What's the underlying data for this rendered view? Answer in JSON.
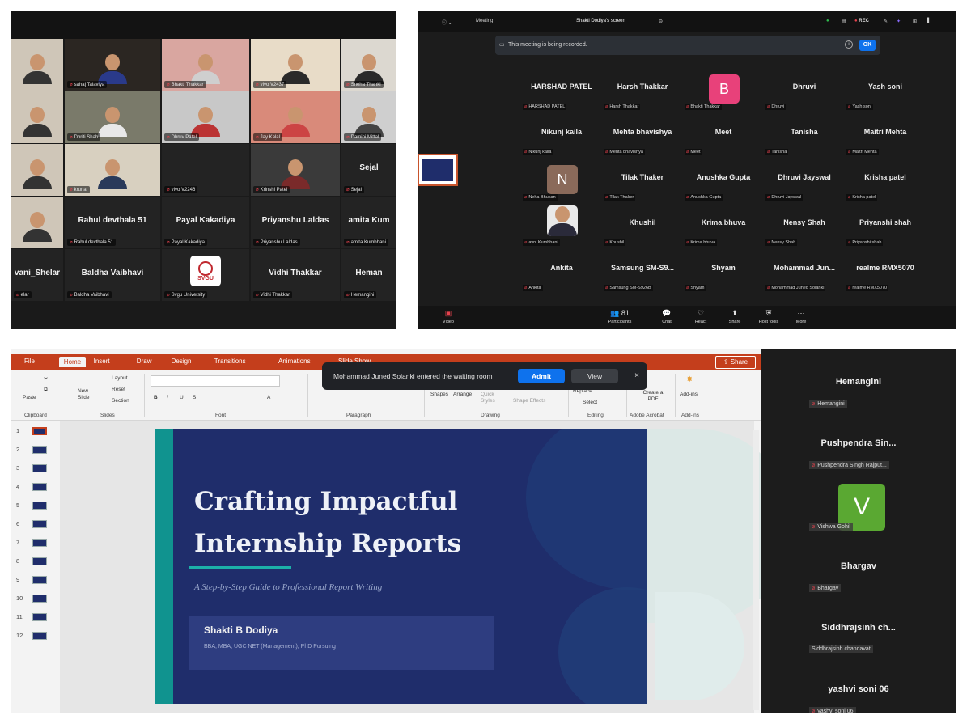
{
  "gallery1": {
    "tiles": [
      {
        "name": "sahaj Talaviya",
        "type": "video",
        "bg": "#2b2622",
        "shirt": "#2a3a8a"
      },
      {
        "name": "Bhakti Thakkar",
        "type": "video",
        "bg": "#d9a6a0",
        "shirt": "#cfcfcf"
      },
      {
        "name": "vivo V2437",
        "type": "video",
        "bg": "#e8dcc8",
        "shirt": "#2a2a2a"
      },
      {
        "name": "Sneha Thanki",
        "type": "video",
        "bg": "#dcd8d0",
        "shirt": "#2a2a2a"
      },
      {
        "name": "Dhriti Shah",
        "type": "video",
        "bg": "#7a7a6a",
        "shirt": "#e8e8e8"
      },
      {
        "name": "Dhruv Patel",
        "type": "video",
        "bg": "#c8c8c8",
        "shirt": "#b33"
      },
      {
        "name": "Jay Kalal",
        "type": "video",
        "bg": "#d98a7a",
        "shirt": "#c44"
      },
      {
        "name": "Damini Mittal",
        "type": "video",
        "bg": "#cfcfcf",
        "shirt": "#444"
      },
      {
        "name": "krunal",
        "type": "video",
        "bg": "#d8d0c0",
        "shirt": "#2a3a5a"
      },
      {
        "name": "vivo V2246",
        "type": "avatar"
      },
      {
        "name": "Krinshi Patel",
        "type": "video",
        "bg": "#3a3a3a",
        "shirt": "#7a2a2a"
      },
      {
        "name": "Sejal",
        "type": "big"
      },
      {
        "name": "Rahul devthala 51",
        "type": "big"
      },
      {
        "name": "Payal Kakadiya",
        "type": "big"
      },
      {
        "name": "Priyanshu Laldas",
        "type": "big"
      },
      {
        "name": "amita Kumbhani",
        "big_label": "amita Kum",
        "type": "big"
      },
      {
        "name": "elar",
        "big_label": "vani_Shelar",
        "type": "big"
      },
      {
        "name": "Baldha Vaibhavi",
        "type": "big"
      },
      {
        "name": "Svgu University",
        "type": "logo"
      },
      {
        "name": "Vidhi Thakkar",
        "type": "big"
      },
      {
        "name": "Hemangini",
        "big_label": "Heman",
        "type": "big"
      }
    ],
    "logo_text": "SVGU"
  },
  "meeting": {
    "tab_meeting": "Meeting",
    "tab_screen": "Shakti Dodiya's screen",
    "rec": "REC",
    "banner": "This meeting is being recorded.",
    "ok": "OK",
    "info": "i",
    "participants": [
      {
        "big": "HARSHAD PATEL",
        "small": "HARSHAD PATEL"
      },
      {
        "big": "Harsh Thakkar",
        "small": "Harsh Thakkar"
      },
      {
        "avatar": "B",
        "avatar_color": "#e8417a",
        "small": "Bhakti Thakkar"
      },
      {
        "big": "Dhruvi",
        "small": "Dhruvi"
      },
      {
        "big": "Yash soni",
        "small": "Yash soni"
      },
      {
        "big": "Nikunj kaila",
        "small": "Nikunj kaila"
      },
      {
        "big": "Mehta bhavishya",
        "small": "Mehta bhavishya"
      },
      {
        "big": "Meet",
        "small": "Meet"
      },
      {
        "big": "Tanisha",
        "small": "Tanisha"
      },
      {
        "big": "Maitri Mehta",
        "small": "Maitri Mehta"
      },
      {
        "avatar": "N",
        "avatar_color": "#8a6a5a",
        "small": "Neha Bhukan"
      },
      {
        "big": "Tilak Thaker",
        "small": "Tilak Thaker"
      },
      {
        "big": "Anushka Gupta",
        "small": "Anushka Gupta"
      },
      {
        "big": "Dhruvi Jayswal",
        "small": "Dhruvi Jayswal"
      },
      {
        "big": "Krisha patel",
        "small": "Krisha patel"
      },
      {
        "photo": true,
        "small": "avni Kumbhani"
      },
      {
        "big": "Khushil",
        "small": "Khushil"
      },
      {
        "big": "Krima bhuva",
        "small": "Krima bhuva"
      },
      {
        "big": "Nensy Shah",
        "small": "Nensy Shah"
      },
      {
        "big": "Priyanshi shah",
        "small": "Priyanshi shah"
      },
      {
        "big": "Ankita",
        "small": "Ankita"
      },
      {
        "big": "Samsung  SM-S9...",
        "small": "Samsung SM-S926B"
      },
      {
        "big": "Shyam",
        "small": "Shyam"
      },
      {
        "big": "Mohammad  Jun...",
        "small": "Mohammad Juned Solanki"
      },
      {
        "big": "realme RMX5070",
        "small": "realme RMX5070"
      }
    ],
    "controls": [
      {
        "icon": "video-icon",
        "glyph": "▣",
        "label": "Video",
        "red": true
      },
      {
        "icon": "participants-icon",
        "glyph": "👥 81",
        "label": "Participants"
      },
      {
        "icon": "chat-icon",
        "glyph": "💬",
        "label": "Chat"
      },
      {
        "icon": "react-icon",
        "glyph": "♡",
        "label": "React"
      },
      {
        "icon": "share-icon",
        "glyph": "⬆",
        "label": "Share"
      },
      {
        "icon": "host-tools-icon",
        "glyph": "⛨",
        "label": "Host tools"
      },
      {
        "icon": "more-icon",
        "glyph": "⋯",
        "label": "More"
      }
    ]
  },
  "ppt": {
    "tabs": [
      "File",
      "Home",
      "Insert",
      "Draw",
      "Design",
      "Transitions",
      "Animations",
      "Slide Show"
    ],
    "active_tab": "Home",
    "share": "Share",
    "ribbon_items": {
      "paste": "Paste",
      "layout": "Layout",
      "reset": "Reset",
      "new_slide": "New Slide",
      "section": "Section",
      "shapes": "Shapes",
      "arrange": "Arrange",
      "quick_styles": "Quick Styles",
      "shape_effects": "Shape Effects",
      "replace": "Replace",
      "select": "Select",
      "create_pdf": "Create a PDF",
      "addins": "Add-ins"
    },
    "groups": [
      "Clipboard",
      "Slides",
      "Font",
      "Paragraph",
      "Drawing",
      "Editing",
      "Adobe Acrobat",
      "Add-ins"
    ],
    "waiting_msg": "Mohammad Juned Solanki entered the waiting room",
    "admit": "Admit",
    "view": "View",
    "close": "×",
    "slide_numbers": [
      "1",
      "2",
      "3",
      "4",
      "5",
      "6",
      "7",
      "8",
      "9",
      "10",
      "11",
      "12"
    ],
    "slide": {
      "title_line1": "Crafting Impactful",
      "title_line2": "Internship Reports",
      "subtitle": "A Step-by-Step Guide to Professional Report Writing",
      "presenter": "Shakti B Dodiya",
      "credentials": "BBA, MBA, UGC NET (Management), PhD Pursuing"
    }
  },
  "sidebar": [
    {
      "big": "Hemangini",
      "small": "Hemangini"
    },
    {
      "big": "Pushpendra  Sin...",
      "small": "Pushpendra Singh Rajput..."
    },
    {
      "avatar": "V",
      "small": "Vishwa Gohil"
    },
    {
      "big": "Bhargav",
      "small": "Bhargav"
    },
    {
      "big": "Siddhrajsinh  ch...",
      "small": "Siddhrajsinh chandavat",
      "nomic": true
    },
    {
      "big": "yashvi soni 06",
      "small": "yashvi soni 06"
    }
  ]
}
